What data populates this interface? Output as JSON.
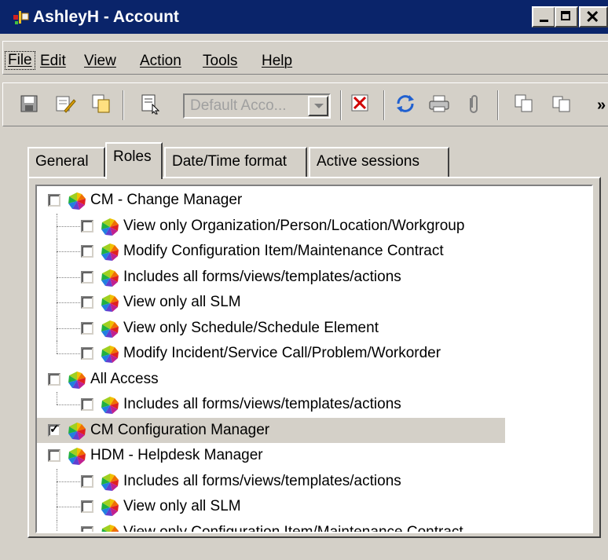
{
  "window": {
    "title": "AshleyH - Account",
    "controls": [
      "minimize",
      "maximize",
      "close"
    ]
  },
  "menubar": {
    "items": [
      {
        "label": "File",
        "selected": true
      },
      {
        "label": "Edit"
      },
      {
        "label": "View"
      },
      {
        "label": "Action"
      },
      {
        "label": "Tools"
      },
      {
        "label": "Help"
      }
    ]
  },
  "toolbar": {
    "buttons": [
      "save-icon",
      "edit-icon",
      "copy-icon",
      "properties-icon",
      "delete-icon",
      "refresh-icon",
      "print-icon",
      "attach-icon",
      "cut-icon",
      "paste-icon"
    ],
    "combo": {
      "value": "Default Acco..."
    },
    "overflow": "»"
  },
  "tabs": [
    {
      "label": "General"
    },
    {
      "label": "Roles",
      "active": true
    },
    {
      "label": "Date/Time format"
    },
    {
      "label": "Active sessions"
    }
  ],
  "roles_tree": [
    {
      "label": "CM - Change Manager",
      "level": 0,
      "checked": false
    },
    {
      "label": "View only Organization/Person/Location/Workgroup",
      "level": 1,
      "checked": false
    },
    {
      "label": "Modify Configuration Item/Maintenance Contract",
      "level": 1,
      "checked": false
    },
    {
      "label": "Includes all forms/views/templates/actions",
      "level": 1,
      "checked": false
    },
    {
      "label": "View only all SLM",
      "level": 1,
      "checked": false
    },
    {
      "label": "View only Schedule/Schedule Element",
      "level": 1,
      "checked": false
    },
    {
      "label": "Modify Incident/Service Call/Problem/Workorder",
      "level": 1,
      "checked": false,
      "last": true
    },
    {
      "label": "All Access",
      "level": 0,
      "checked": false
    },
    {
      "label": "Includes all forms/views/templates/actions",
      "level": 1,
      "checked": false,
      "last": true
    },
    {
      "label": "CM Configuration Manager",
      "level": 0,
      "checked": true,
      "selected": true
    },
    {
      "label": "HDM - Helpdesk Manager",
      "level": 0,
      "checked": false
    },
    {
      "label": "Includes all forms/views/templates/actions",
      "level": 1,
      "checked": false
    },
    {
      "label": "View only all SLM",
      "level": 1,
      "checked": false
    },
    {
      "label": "View only Configuration Item/Maintenance Contract",
      "level": 1,
      "checked": false
    }
  ],
  "colors": {
    "titlebar": "#0a246a",
    "face": "#d4d0c8",
    "selection": "#d4d0c8"
  }
}
